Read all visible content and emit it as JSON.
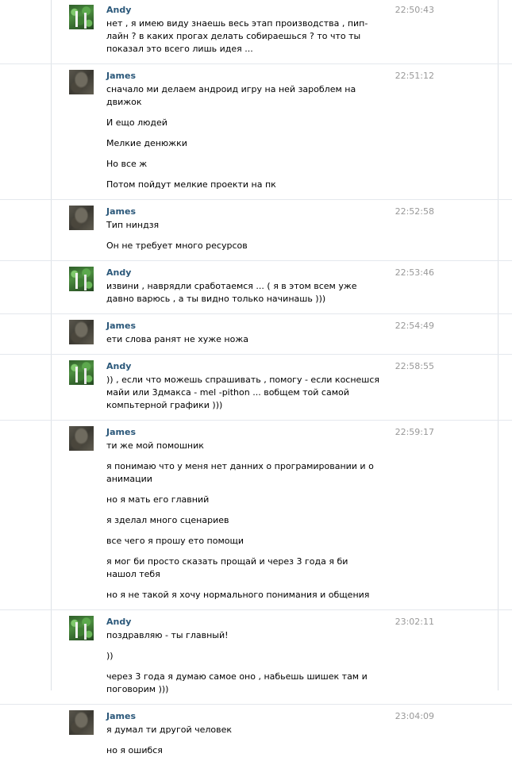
{
  "messages": [
    {
      "author": "Andy",
      "time": "22:50:43",
      "avatar": "andy",
      "lines": [
        "нет , я имею виду знаешь весь этап производства , пип-лайн ? в каких прогах делать собираешься ? то что ты показал это всего лишь идея ..."
      ]
    },
    {
      "author": "James",
      "time": "22:51:12",
      "avatar": "james",
      "lines": [
        "сначало ми делаем андроид игру на ней зароблем на движок",
        "И ещо людей",
        "Мелкие денюжки",
        "Но все ж",
        "Потом пойдут мелкие проекти на пк"
      ]
    },
    {
      "author": "James",
      "time": "22:52:58",
      "avatar": "james",
      "lines": [
        "Тип ниндзя",
        "Он не требует много ресурсов"
      ]
    },
    {
      "author": "Andy",
      "time": "22:53:46",
      "avatar": "andy",
      "lines": [
        "извини , наврядли сработаемся ... ( я в этом всем уже давно варюсь , а ты видно только начинашь )))"
      ]
    },
    {
      "author": "James",
      "time": "22:54:49",
      "avatar": "james",
      "lines": [
        "ети слова ранят не хуже ножа"
      ]
    },
    {
      "author": "Andy",
      "time": "22:58:55",
      "avatar": "andy",
      "lines": [
        ")) , если что можешь спрашивать , помогу - если коснешся майи или 3дмакса - mel -pithon ... вобщем той самой компьтерной графики )))"
      ]
    },
    {
      "author": "James",
      "time": "22:59:17",
      "avatar": "james",
      "lines": [
        "ти же мой помошник",
        "я понимаю что у меня нет данних о програмировании и о анимации",
        "но я мать его главний",
        "я зделал много сценариев",
        "все чего я прошу ето помощи",
        "я мог би просто сказать прощай и через 3 года я би нашол тебя",
        "но я не такой я хочу нормального понимания и общения"
      ]
    },
    {
      "author": "Andy",
      "time": "23:02:11",
      "avatar": "andy",
      "lines": [
        "поздравляю - ты главный!",
        "))",
        "через 3 года я думаю самое оно , набьешь шишек там и поговорим )))"
      ]
    },
    {
      "author": "James",
      "time": "23:04:09",
      "avatar": "james",
      "lines": [
        "я думал ти другой человек",
        "но я ошибся"
      ]
    }
  ]
}
